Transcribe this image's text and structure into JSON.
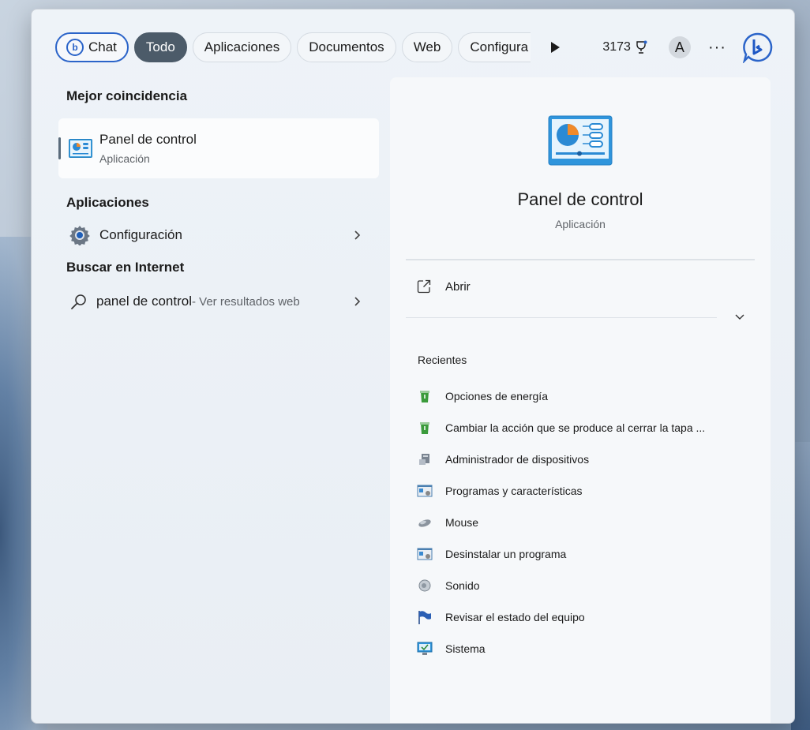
{
  "filters": {
    "chat": "Chat",
    "todo": "Todo",
    "aplicaciones": "Aplicaciones",
    "documentos": "Documentos",
    "web": "Web",
    "configuracion": "Configura",
    "points": "3173",
    "avatar_letter": "A",
    "more": "···"
  },
  "left": {
    "best_match_header": "Mejor coincidencia",
    "best_match": {
      "title": "Panel de control",
      "subtitle": "Aplicación"
    },
    "apps_header": "Aplicaciones",
    "apps": [
      {
        "label": "Configuración"
      }
    ],
    "web_header": "Buscar en Internet",
    "web_result": {
      "query": "panel de control",
      "suffix": " - Ver resultados web"
    }
  },
  "right": {
    "title": "Panel de control",
    "subtitle": "Aplicación",
    "open_label": "Abrir",
    "recent_header": "Recientes",
    "recent": [
      {
        "label": "Opciones de energía",
        "icon": "power-options-icon"
      },
      {
        "label": "Cambiar la acción que se produce al cerrar la tapa ...",
        "icon": "power-options-icon"
      },
      {
        "label": "Administrador de dispositivos",
        "icon": "device-manager-icon"
      },
      {
        "label": "Programas y características",
        "icon": "programs-icon"
      },
      {
        "label": "Mouse",
        "icon": "mouse-icon"
      },
      {
        "label": "Desinstalar un programa",
        "icon": "programs-icon"
      },
      {
        "label": "Sonido",
        "icon": "sound-icon"
      },
      {
        "label": "Revisar el estado del equipo",
        "icon": "flag-icon"
      },
      {
        "label": "Sistema",
        "icon": "system-icon"
      }
    ]
  },
  "colors": {
    "accent": "#2b64c9",
    "active_pill": "#4c5b69"
  }
}
